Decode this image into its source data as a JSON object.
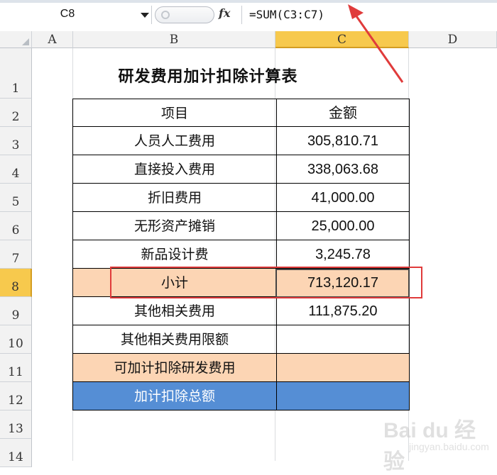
{
  "formula_bar": {
    "name_box": "C8",
    "formula": "=SUM(C3:C7)",
    "fx_label": "fx"
  },
  "columns": [
    "A",
    "B",
    "C",
    "D"
  ],
  "selected_column": "C",
  "rows": [
    "1",
    "2",
    "3",
    "4",
    "5",
    "6",
    "7",
    "8",
    "9",
    "10",
    "11",
    "12",
    "13",
    "14"
  ],
  "selected_row": "8",
  "sheet_title": "研发费用加计扣除计算表",
  "table": {
    "header": {
      "item": "项目",
      "amount": "金额"
    },
    "rows": [
      {
        "item": "人员人工费用",
        "amount": "305,810.71"
      },
      {
        "item": "直接投入费用",
        "amount": "338,063.68"
      },
      {
        "item": "折旧费用",
        "amount": "41,000.00"
      },
      {
        "item": "无形资产摊销",
        "amount": "25,000.00"
      },
      {
        "item": "新品设计费",
        "amount": "3,245.78"
      },
      {
        "item": "小计",
        "amount": "713,120.17"
      },
      {
        "item": "其他相关费用",
        "amount": "111,875.20"
      },
      {
        "item": "其他相关费用限额",
        "amount": ""
      },
      {
        "item": "可加计扣除研发费用",
        "amount": ""
      },
      {
        "item": "加计扣除总额",
        "amount": ""
      }
    ]
  },
  "colors": {
    "peach_fill": "#fcd5b4",
    "blue_fill": "#558ed5",
    "annotation_red": "#e03b3b",
    "selected_header": "#f7c94d"
  },
  "watermark": {
    "main": "Bai du 经验",
    "sub": "jingyan.baidu.com"
  }
}
